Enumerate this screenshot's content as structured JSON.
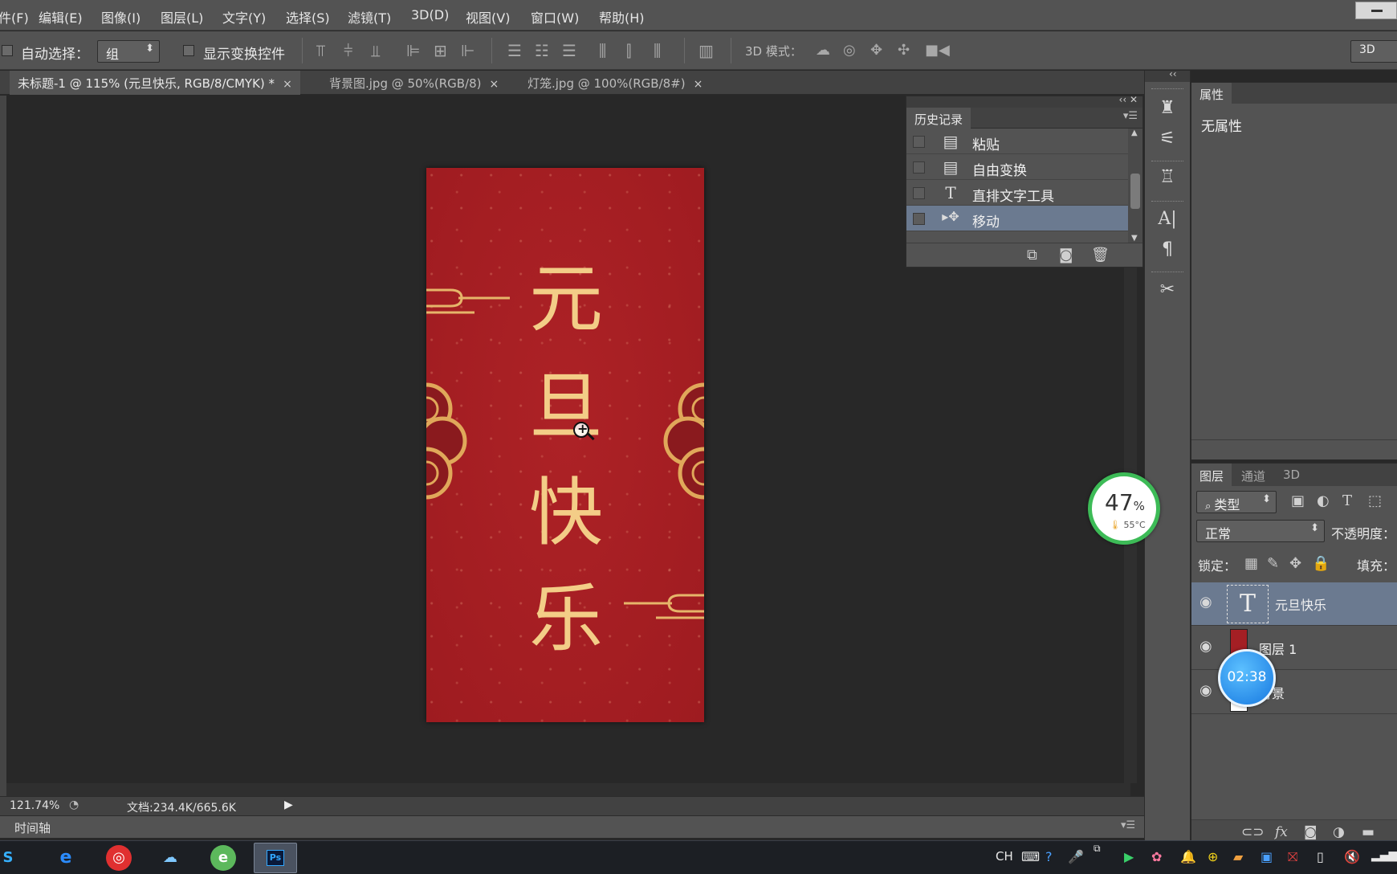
{
  "menu": [
    "文件(F)",
    "编辑(E)",
    "图像(I)",
    "图层(L)",
    "文字(Y)",
    "选择(S)",
    "滤镜(T)",
    "3D(D)",
    "视图(V)",
    "窗口(W)",
    "帮助(H)"
  ],
  "options": {
    "auto_select_label": "自动选择：",
    "auto_select_value": "组",
    "show_transform_label": "显示变换控件",
    "mode_3d_label": "3D 模式：",
    "workspace": "3D"
  },
  "tabs": [
    {
      "label": "未标题-1 @ 115% (元旦快乐, RGB/8/CMYK) *",
      "close": "×"
    },
    {
      "label": "背景图.jpg @ 50%(RGB/8)",
      "close": "×"
    },
    {
      "label": "灯笼.jpg @ 100%(RGB/8#)",
      "close": "×"
    }
  ],
  "document": {
    "chars": [
      "元",
      "旦",
      "快",
      "乐"
    ],
    "bg_color": "#a41f24",
    "text_color": "#f3cd87"
  },
  "history": {
    "title": "历史记录",
    "items": [
      {
        "icon": "document-icon",
        "label": "粘贴"
      },
      {
        "icon": "document-icon",
        "label": "自由变换"
      },
      {
        "icon": "type-icon",
        "label": "直排文字工具"
      },
      {
        "icon": "move-icon",
        "label": "移动"
      }
    ]
  },
  "properties": {
    "title": "属性",
    "empty": "无属性"
  },
  "layers": {
    "tabs": [
      "图层",
      "通道",
      "3D"
    ],
    "filter_type": "类型",
    "blend_mode": "正常",
    "opacity_label": "不透明度：",
    "lock_label": "锁定：",
    "fill_label": "填充：",
    "items": [
      {
        "name": "元旦快乐",
        "type": "text"
      },
      {
        "name": "图层 1",
        "type": "image"
      },
      {
        "name": "背景",
        "type": "background"
      }
    ]
  },
  "status": {
    "zoom": "121.74%",
    "doc_size": "文档:234.4K/665.6K",
    "timeline": "时间轴"
  },
  "widgets": {
    "cpu_percent": "47",
    "cpu_unit": "%",
    "cpu_temp": "55°C",
    "timer": "02:38"
  },
  "taskbar": {
    "ps_label": "Ps",
    "ime": "CH"
  }
}
